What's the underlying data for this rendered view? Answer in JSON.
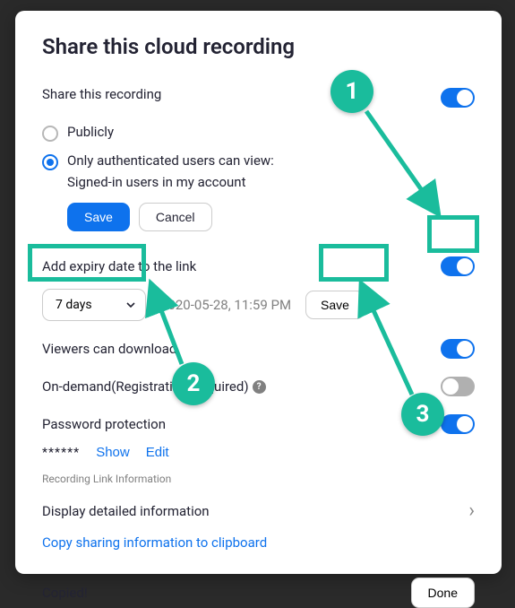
{
  "title": "Share this cloud recording",
  "share_section_label": "Share this recording",
  "radio_publicly": "Publicly",
  "radio_auth": "Only authenticated users can view:",
  "radio_auth_sub": "Signed-in users in my account",
  "save_label": "Save",
  "cancel_label": "Cancel",
  "expiry_label": "Add expiry date to the link",
  "expiry_select_value": "7 days",
  "expiry_date_text": "2020-05-28, 11:59 PM",
  "expiry_save_label": "Save",
  "viewers_download_label": "Viewers can download",
  "ondemand_label": "On-demand(Registration Required)",
  "password_label": "Password protection",
  "password_mask": "******",
  "show_label": "Show",
  "edit_label": "Edit",
  "recording_info_heading": "Recording Link Information",
  "display_detailed_label": "Display detailed information",
  "copy_clipboard_label": "Copy sharing information to clipboard",
  "copied_label": "Copied!",
  "done_label": "Done",
  "toggles": {
    "share": true,
    "expiry": true,
    "download": true,
    "ondemand": false,
    "password": true
  },
  "annotations": {
    "b1": "1",
    "b2": "2",
    "b3": "3"
  }
}
